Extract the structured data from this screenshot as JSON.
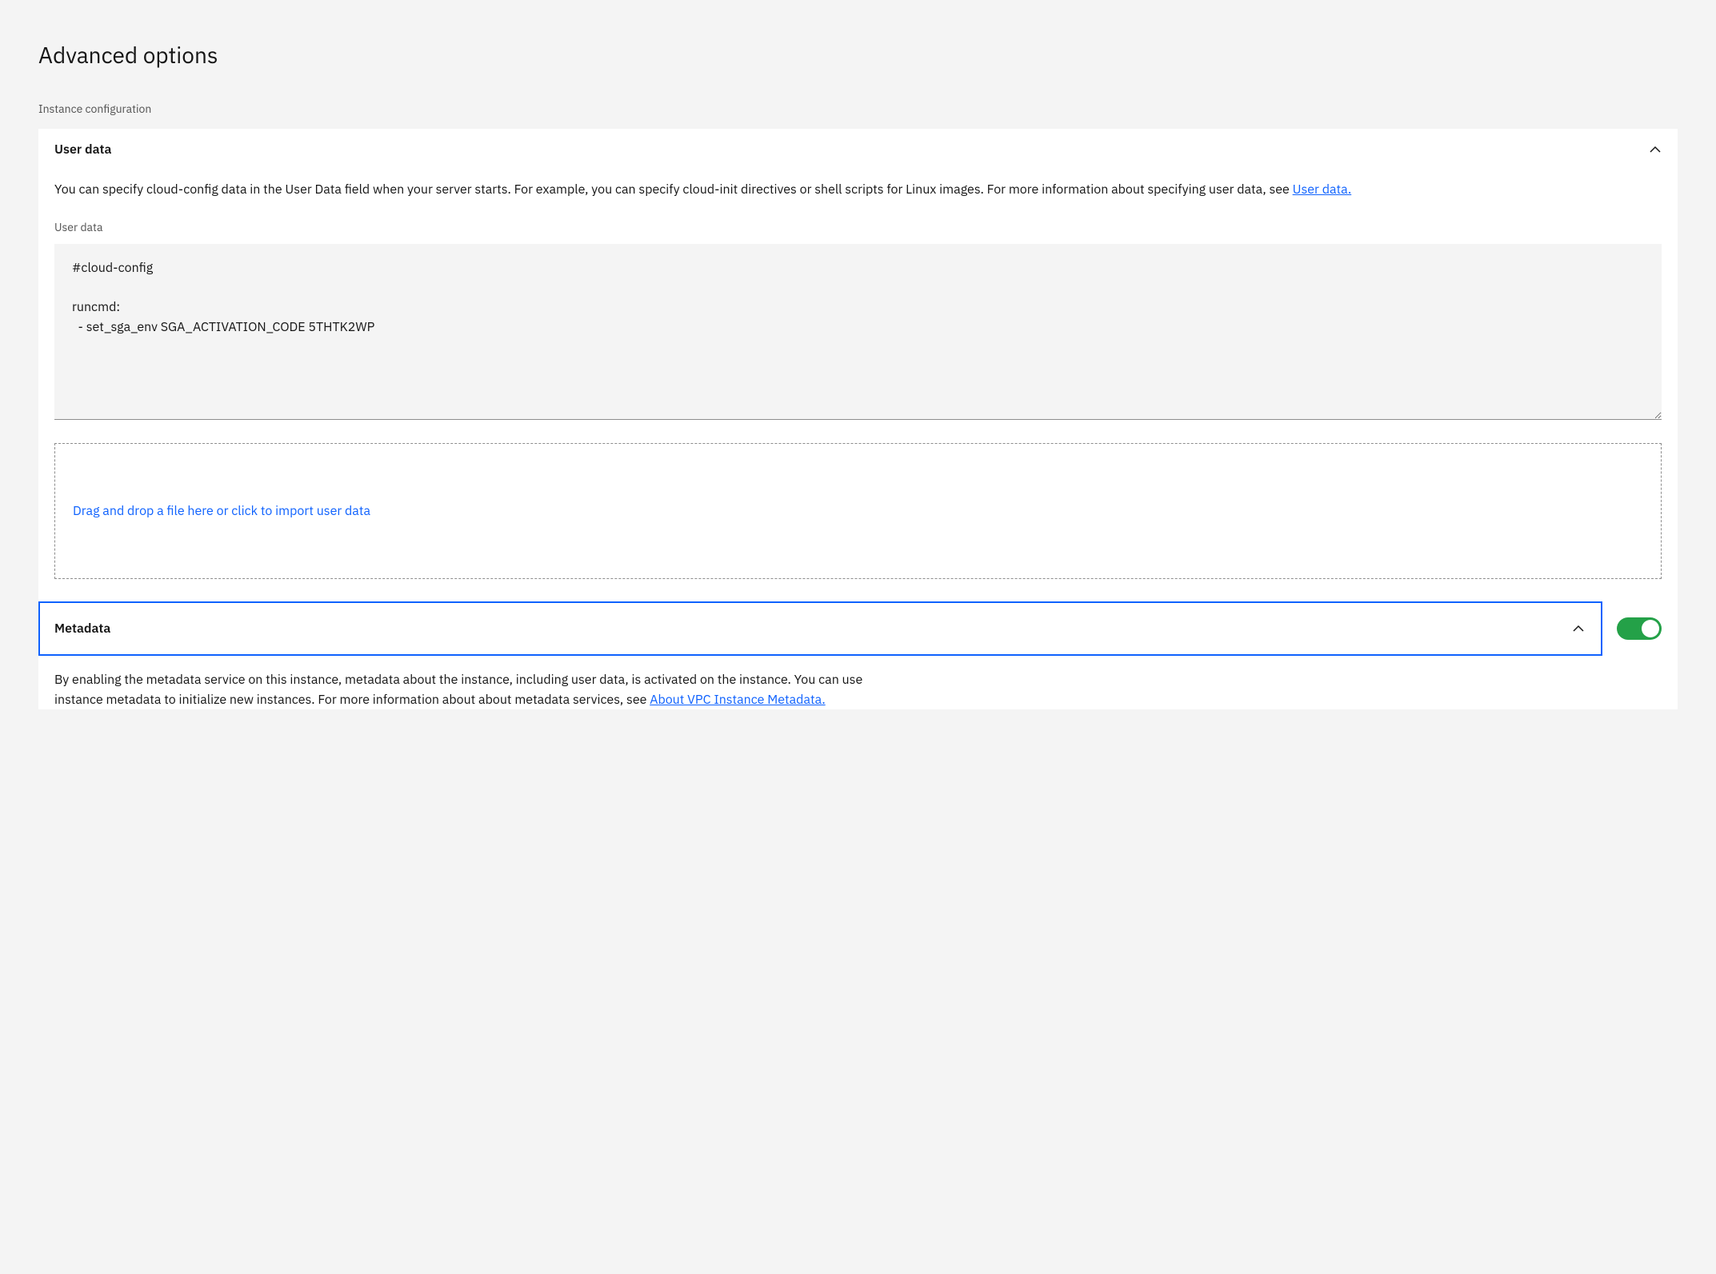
{
  "page": {
    "title": "Advanced options",
    "section_label": "Instance configuration"
  },
  "user_data": {
    "title": "User data",
    "description_prefix": "You can specify cloud-config data in the User Data field when your server starts. For example, you can specify cloud-init directives or shell scripts for Linux images. For more information about specifying user data, see ",
    "description_link": "User data.",
    "field_label": "User data",
    "textarea_value": "#cloud-config\n\nruncmd:\n  - set_sga_env SGA_ACTIVATION_CODE 5THTK2WP",
    "dropzone_text": "Drag and drop a file here or click to import user data"
  },
  "metadata": {
    "title": "Metadata",
    "toggle_on": true,
    "description_prefix": "By enabling the metadata service on this instance, metadata about the instance, including user data, is activated on the instance. You can use instance metadata to initialize new instances. For more information about about metadata services, see ",
    "description_link": "About VPC Instance Metadata."
  }
}
